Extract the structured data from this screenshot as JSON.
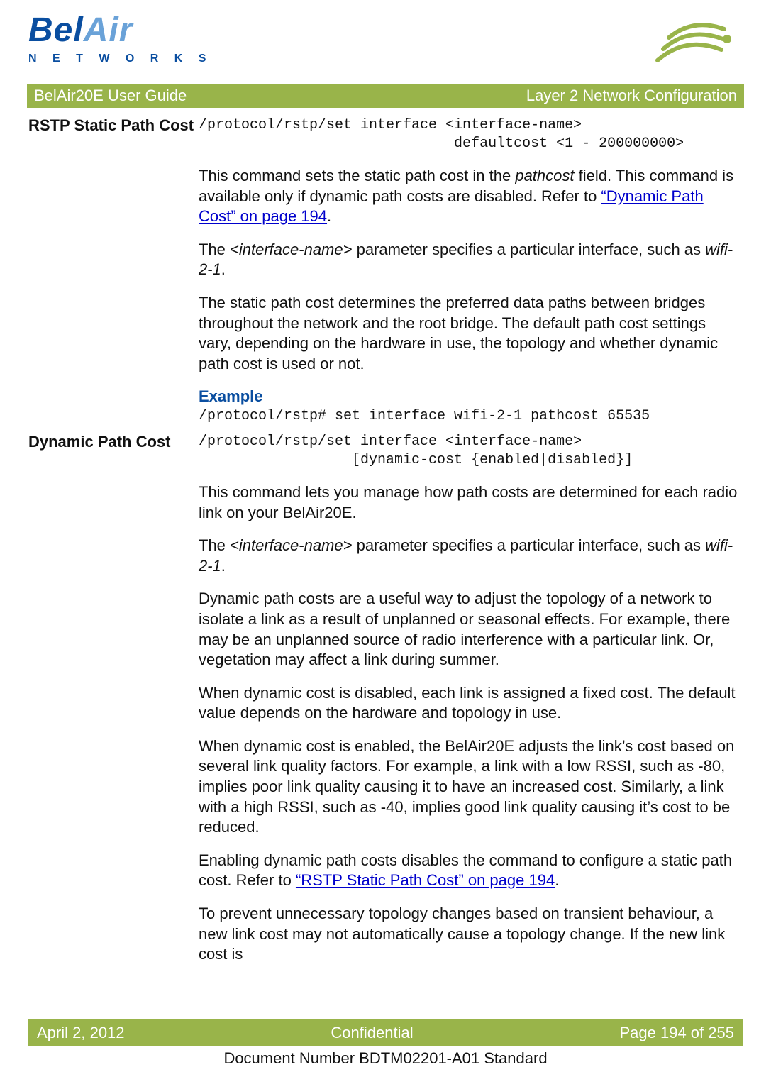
{
  "logo": {
    "bel": "Bel",
    "air": "Air",
    "sub": "N E T W O R K S"
  },
  "bar": {
    "left": "BelAir20E User Guide",
    "right": "Layer 2 Network Configuration"
  },
  "sec1": {
    "heading": "RSTP Static Path Cost",
    "cmd": "/protocol/rstp/set interface <interface-name>\n                              defaultcost <1 - 200000000>",
    "p1a": "This command sets the static path cost in the ",
    "p1b": "pathcost",
    "p1c": " field. This command is available only if dynamic path costs are disabled. Refer to ",
    "link1": "“Dynamic Path Cost” on page 194",
    "p1d": ".",
    "p2a": "The ",
    "p2b": "<interface-name>",
    "p2c": " parameter specifies a particular interface, such as ",
    "p2d": "wifi-2-1",
    "p2e": ".",
    "p3": "The static path cost determines the preferred data paths between bridges throughout the network and the root bridge. The default path cost settings vary, depending on the hardware in use, the topology and whether dynamic path cost is used or not.",
    "exhead": "Example",
    "excmd": "/protocol/rstp# set interface wifi-2-1 pathcost 65535"
  },
  "sec2": {
    "heading": "Dynamic Path Cost",
    "cmd": "/protocol/rstp/set interface <interface-name>\n                  [dynamic-cost {enabled|disabled}]",
    "p1": "This command lets you manage how path costs are determined for each radio link on your BelAir20E.",
    "p2a": "The ",
    "p2b": "<interface-name>",
    "p2c": " parameter specifies a particular interface, such as ",
    "p2d": "wifi-2-1",
    "p2e": ".",
    "p3": "Dynamic path costs are a useful way to adjust the topology of a network to isolate a link as a result of unplanned or seasonal effects. For example, there may be an unplanned source of radio interference with a particular link. Or, vegetation may affect a link during summer.",
    "p4": "When dynamic cost is disabled, each link is assigned a fixed cost. The default value depends on the hardware and topology in use.",
    "p5": "When dynamic cost is enabled, the BelAir20E adjusts the link’s cost based on several link quality factors. For example, a link with a low RSSI, such as -80, implies poor link quality causing it to have an increased cost. Similarly, a link with a high RSSI, such as -40, implies good link quality causing it’s cost to be reduced.",
    "p6a": "Enabling dynamic path costs disables the command to configure a static path cost. Refer to ",
    "link2": "“RSTP Static Path Cost” on page 194",
    "p6b": ".",
    "p7": "To prevent unnecessary topology changes based on transient behaviour, a new link cost may not automatically cause a topology change. If the new link cost is"
  },
  "footer": {
    "left": "April 2, 2012",
    "center": "Confidential",
    "right": "Page 194 of 255"
  },
  "docnum": "Document Number BDTM02201-A01 Standard"
}
